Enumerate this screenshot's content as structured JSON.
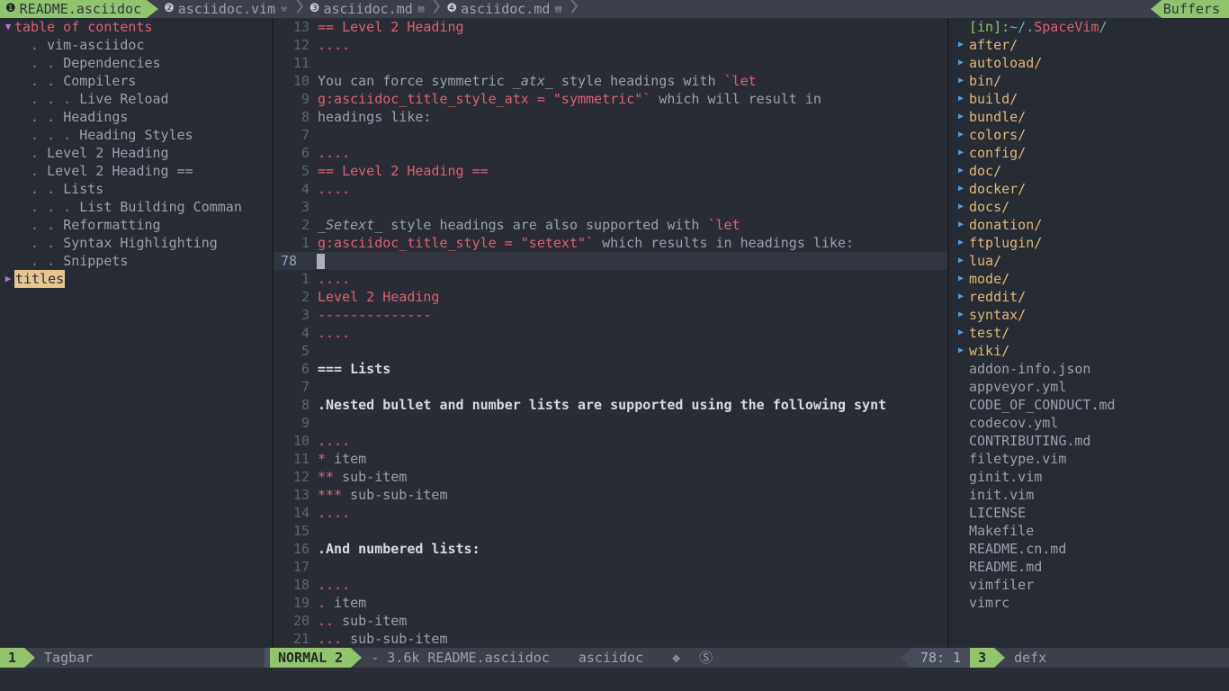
{
  "tabline": {
    "tabs": [
      {
        "num": "❶",
        "label": "README.asciidoc",
        "glyph": "",
        "active": true
      },
      {
        "num": "❷",
        "label": "asciidoc.vim",
        "glyph": "⚒",
        "active": false
      },
      {
        "num": "❸",
        "label": "asciidoc.md",
        "glyph": "▤",
        "active": false
      },
      {
        "num": "❹",
        "label": "asciidoc.md",
        "glyph": "▤",
        "active": false
      }
    ],
    "right_label": "Buffers"
  },
  "tagbar": {
    "title": "table of contents",
    "kind_label": "titles",
    "items": [
      {
        "dots": ".",
        "label": "vim-asciidoc"
      },
      {
        "dots": ". .",
        "label": "Dependencies"
      },
      {
        "dots": ". .",
        "label": "Compilers"
      },
      {
        "dots": ". . .",
        "label": "Live Reload"
      },
      {
        "dots": ". .",
        "label": "Headings"
      },
      {
        "dots": ". . .",
        "label": "Heading Styles"
      },
      {
        "dots": ".",
        "label": "Level 2 Heading"
      },
      {
        "dots": ".",
        "label": "Level 2 Heading =="
      },
      {
        "dots": ". .",
        "label": "Lists"
      },
      {
        "dots": ". . .",
        "label": "List Building Comman"
      },
      {
        "dots": ". .",
        "label": "Reformatting"
      },
      {
        "dots": ". .",
        "label": "Syntax Highlighting"
      },
      {
        "dots": ". .",
        "label": "Snippets"
      }
    ]
  },
  "editor": {
    "filetype": "asciidoc",
    "cursor_line_number": "78",
    "lines": [
      {
        "num": "13",
        "spans": [
          {
            "t": "== Level 2 Heading",
            "c": "c-red"
          }
        ]
      },
      {
        "num": "12",
        "spans": [
          {
            "t": "....",
            "c": "c-red"
          }
        ]
      },
      {
        "num": "11",
        "spans": [
          {
            "t": "",
            "c": "c-default"
          }
        ]
      },
      {
        "num": "10",
        "spans": [
          {
            "t": "You can force symmetric ",
            "c": "c-default"
          },
          {
            "t": "_atx_",
            "c": "c-italic"
          },
          {
            "t": " style headings with ",
            "c": "c-default"
          },
          {
            "t": "`let",
            "c": "c-red"
          }
        ]
      },
      {
        "num": "9",
        "spans": [
          {
            "t": "g:asciidoc_title_style_atx = \"symmetric\"`",
            "c": "c-red"
          },
          {
            "t": " which will result in",
            "c": "c-default"
          }
        ]
      },
      {
        "num": "8",
        "spans": [
          {
            "t": "headings like:",
            "c": "c-default"
          }
        ]
      },
      {
        "num": "7",
        "spans": [
          {
            "t": "",
            "c": "c-default"
          }
        ]
      },
      {
        "num": "6",
        "spans": [
          {
            "t": "....",
            "c": "c-red"
          }
        ]
      },
      {
        "num": "5",
        "spans": [
          {
            "t": "== Level 2 Heading ==",
            "c": "c-red"
          }
        ]
      },
      {
        "num": "4",
        "spans": [
          {
            "t": "....",
            "c": "c-red"
          }
        ]
      },
      {
        "num": "3",
        "spans": [
          {
            "t": "",
            "c": "c-default"
          }
        ]
      },
      {
        "num": "2",
        "spans": [
          {
            "t": "_Setext_",
            "c": "c-italic"
          },
          {
            "t": " style headings are also supported with ",
            "c": "c-default"
          },
          {
            "t": "`let",
            "c": "c-red"
          }
        ]
      },
      {
        "num": "1",
        "spans": [
          {
            "t": "g:asciidoc_title_style = \"setext\"`",
            "c": "c-red"
          },
          {
            "t": " which results in headings like:",
            "c": "c-default"
          }
        ]
      },
      {
        "num": "78",
        "cursor": true,
        "spans": []
      },
      {
        "num": "1",
        "spans": [
          {
            "t": "....",
            "c": "c-red"
          }
        ]
      },
      {
        "num": "2",
        "spans": [
          {
            "t": "Level 2 Heading",
            "c": "c-red"
          }
        ]
      },
      {
        "num": "3",
        "spans": [
          {
            "t": "--------------",
            "c": "c-red"
          }
        ]
      },
      {
        "num": "4",
        "spans": [
          {
            "t": "....",
            "c": "c-red"
          }
        ]
      },
      {
        "num": "5",
        "spans": [
          {
            "t": "",
            "c": "c-default"
          }
        ]
      },
      {
        "num": "6",
        "spans": [
          {
            "t": "=== Lists",
            "c": "c-white"
          }
        ]
      },
      {
        "num": "7",
        "spans": [
          {
            "t": "",
            "c": "c-default"
          }
        ]
      },
      {
        "num": "8",
        "spans": [
          {
            "t": ".Nested bullet and number lists are supported using the following synt",
            "c": "c-white"
          }
        ]
      },
      {
        "num": "9",
        "spans": [
          {
            "t": "",
            "c": "c-default"
          }
        ]
      },
      {
        "num": "10",
        "spans": [
          {
            "t": "....",
            "c": "c-red"
          }
        ]
      },
      {
        "num": "11",
        "spans": [
          {
            "t": "*",
            "c": "c-red"
          },
          {
            "t": " item",
            "c": "c-default"
          }
        ]
      },
      {
        "num": "12",
        "spans": [
          {
            "t": "**",
            "c": "c-red"
          },
          {
            "t": " sub-item",
            "c": "c-default"
          }
        ]
      },
      {
        "num": "13",
        "spans": [
          {
            "t": "***",
            "c": "c-red"
          },
          {
            "t": " sub-sub-item",
            "c": "c-default"
          }
        ]
      },
      {
        "num": "14",
        "spans": [
          {
            "t": "....",
            "c": "c-red"
          }
        ]
      },
      {
        "num": "15",
        "spans": [
          {
            "t": "",
            "c": "c-default"
          }
        ]
      },
      {
        "num": "16",
        "spans": [
          {
            "t": ".And numbered lists:",
            "c": "c-white"
          }
        ]
      },
      {
        "num": "17",
        "spans": [
          {
            "t": "",
            "c": "c-default"
          }
        ]
      },
      {
        "num": "18",
        "spans": [
          {
            "t": "....",
            "c": "c-red"
          }
        ]
      },
      {
        "num": "19",
        "spans": [
          {
            "t": ".",
            "c": "c-red"
          },
          {
            "t": " item",
            "c": "c-default"
          }
        ]
      },
      {
        "num": "20",
        "spans": [
          {
            "t": "..",
            "c": "c-red"
          },
          {
            "t": " sub-item",
            "c": "c-default"
          }
        ]
      },
      {
        "num": "21",
        "spans": [
          {
            "t": "...",
            "c": "c-red"
          },
          {
            "t": " sub-sub-item",
            "c": "c-default"
          }
        ]
      }
    ]
  },
  "defx": {
    "header": {
      "prefix": "[in]:",
      "tilde": " ~/.",
      "name": "SpaceVim",
      "slash": "/"
    },
    "entries": [
      {
        "label": "after/",
        "type": "dir"
      },
      {
        "label": "autoload/",
        "type": "dir"
      },
      {
        "label": "bin/",
        "type": "dir"
      },
      {
        "label": "build/",
        "type": "dir"
      },
      {
        "label": "bundle/",
        "type": "dir"
      },
      {
        "label": "colors/",
        "type": "dir"
      },
      {
        "label": "config/",
        "type": "dir"
      },
      {
        "label": "doc/",
        "type": "dir"
      },
      {
        "label": "docker/",
        "type": "dir"
      },
      {
        "label": "docs/",
        "type": "dir"
      },
      {
        "label": "donation/",
        "type": "dir"
      },
      {
        "label": "ftplugin/",
        "type": "dir"
      },
      {
        "label": "lua/",
        "type": "dir"
      },
      {
        "label": "mode/",
        "type": "dir"
      },
      {
        "label": "reddit/",
        "type": "dir"
      },
      {
        "label": "syntax/",
        "type": "dir"
      },
      {
        "label": "test/",
        "type": "dir"
      },
      {
        "label": "wiki/",
        "type": "dir"
      },
      {
        "label": "addon-info.json",
        "type": "file"
      },
      {
        "label": "appveyor.yml",
        "type": "file"
      },
      {
        "label": "CODE_OF_CONDUCT.md",
        "type": "file"
      },
      {
        "label": "codecov.yml",
        "type": "file"
      },
      {
        "label": "CONTRIBUTING.md",
        "type": "file"
      },
      {
        "label": "filetype.vim",
        "type": "file"
      },
      {
        "label": "ginit.vim",
        "type": "file"
      },
      {
        "label": "init.vim",
        "type": "file"
      },
      {
        "label": "LICENSE",
        "type": "file"
      },
      {
        "label": "Makefile",
        "type": "file"
      },
      {
        "label": "README.cn.md",
        "type": "file"
      },
      {
        "label": "README.md",
        "type": "file"
      },
      {
        "label": "vimfiler",
        "type": "file"
      },
      {
        "label": "vimrc",
        "type": "file"
      }
    ]
  },
  "statusline": {
    "left_window_number": "1",
    "left_window_name": "Tagbar",
    "mode": "NORMAL",
    "mode_window_number": "2",
    "file_size": "- 3.6k",
    "file_name": "README.asciidoc",
    "filetype": "asciidoc",
    "icons": "❖ Ⓢ",
    "position": "78:   1",
    "right_window_number": "3",
    "right_window_name": "defx"
  },
  "colors": {
    "accent_green": "#92c46d",
    "red": "#dd6073",
    "dir_orange": "#e0b87a",
    "fg": "#9aa0ae",
    "bg": "#292c35",
    "panel_bg": "#272b33",
    "tabline_bg": "#3b404b",
    "arrow_blue": "#4b9fd8",
    "purple": "#b873d6"
  }
}
